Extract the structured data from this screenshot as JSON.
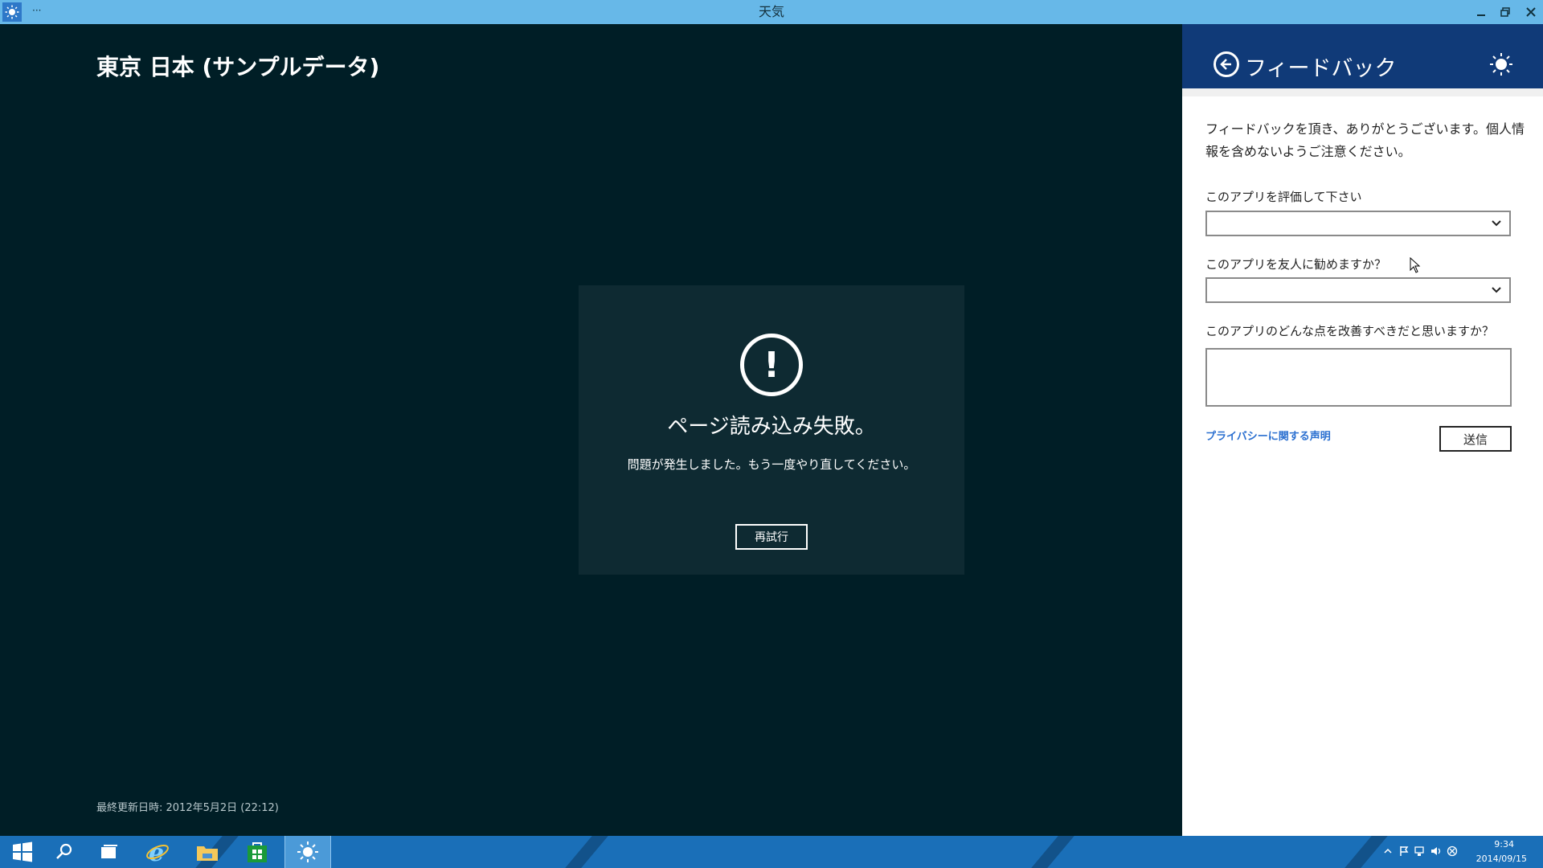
{
  "window": {
    "title": "天気",
    "menu_label": "···"
  },
  "app": {
    "location": "東京 日本 (サンプルデータ)",
    "last_updated": "最終更新日時: 2012年5月2日 (22:12)",
    "error": {
      "icon": "exclamation-circle-icon",
      "symbol": "!",
      "title": "ページ読み込み失敗。",
      "message": "問題が発生しました。もう一度やり直してください。",
      "retry_label": "再試行"
    }
  },
  "feedback": {
    "title": "フィードバック",
    "intro": "フィードバックを頂き、ありがとうございます。個人情報を含めないようご注意ください。",
    "rate_label": "このアプリを評価して下さい",
    "rate_value": "",
    "recommend_label": "このアプリを友人に勧めますか？",
    "recommend_value": "",
    "improve_label": "このアプリのどんな点を改善すべきだと思いますか？",
    "improve_value": "",
    "privacy_link": "プライバシーに関する声明",
    "send_label": "送信"
  },
  "taskbar": {
    "items": [
      "start-icon",
      "search-icon",
      "task-view-icon",
      "ie-icon",
      "file-explorer-icon",
      "store-icon",
      "weather-icon"
    ],
    "clock_time": "9:34",
    "clock_date": "2014/09/15"
  },
  "colors": {
    "titlebar": "#67b8e8",
    "app_bg": "#001e26",
    "pane_header": "#103a78",
    "taskbar": "#1a6fb8",
    "link": "#2a6fd0"
  }
}
